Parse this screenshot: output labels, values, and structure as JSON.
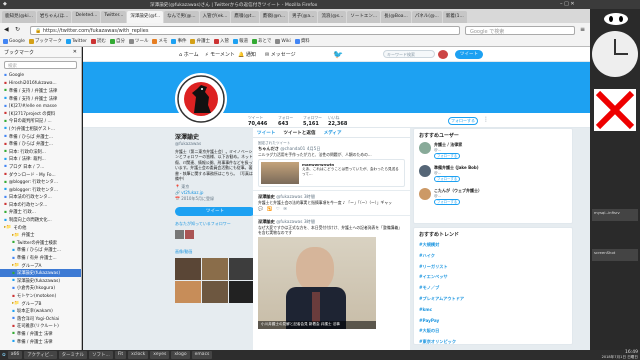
{
  "window": {
    "title": "深澤諭史(@fukazawas)さん | Twitterからの返信付きツイート - Mozilla Firefox"
  },
  "tabs": [
    "鹿知見(@ki...",
    "岩ちゃん(ほ...",
    "Deleted...",
    "Twitter...",
    "深澤諭史(@f...",
    "なんで男(@...",
    "入管が(ek...",
    "鷹嶺(@t...",
    "鷹嶺(@n...",
    "男子(@a...",
    "流浪(@s...",
    "ソートエン...",
    "長(@Boa...",
    "パネル(@...",
    "新着(1..."
  ],
  "toolbar": {
    "url": "https://twitter.com/fukazawas/with_replies",
    "search_placeholder": "Google で検索"
  },
  "bookmarks": [
    "Google",
    "ブックマーク",
    "Twitter",
    "読む",
    "自分",
    "ツール",
    "メモ",
    "事件",
    "弁護士",
    "入管",
    "報道",
    "あとで",
    "Wiki",
    "資料"
  ],
  "sidebar": {
    "title": "ブックマーク",
    "search_placeholder": "検索",
    "items": [
      {
        "label": "Google"
      },
      {
        "label": "Hiroshi2016fukzawa..."
      },
      {
        "label": "準備 / 支持 / 弁護士 法律"
      },
      {
        "label": "準備 / 支持 / 弁護士 法律"
      },
      {
        "label": "[K]27/#/elle en masse"
      },
      {
        "label": "[K]2717project の資料"
      },
      {
        "label": "今日の裁判所日記 / ..."
      },
      {
        "label": "(ク)弁護士相談ゲスト..."
      },
      {
        "label": "準備 / ひらば 弁護士..."
      },
      {
        "label": "準備 / ひらば 弁護士..."
      },
      {
        "label": "日本: 行政の法制..."
      },
      {
        "label": "日本 / 法律: 裁判..."
      },
      {
        "label": "ブログ 日本 / フ..."
      },
      {
        "label": "ダウンロード - My Fo..."
      },
      {
        "label": "@blogger: 行政センタ..."
      },
      {
        "label": "@blogger: 行政センタ..."
      },
      {
        "label": "日本法の行政センタ..."
      },
      {
        "label": "日本の行政センタ..."
      },
      {
        "label": "弁護士 行政..."
      },
      {
        "label": "制度向上の問題文化..."
      },
      {
        "label": "その他"
      },
      {
        "label": "弁護士"
      },
      {
        "label": "Twitterの弁護士検索"
      },
      {
        "label": "準備 / ひらば 弁護士..."
      },
      {
        "label": "準備 / 有弁 弁護士..."
      },
      {
        "label": "グループA"
      },
      {
        "label": "深澤諭史(fukazawas)"
      },
      {
        "label": "深澤諭史(fukazawas)"
      },
      {
        "label": "小倉秀夫(hkogura)"
      },
      {
        "label": "モトケン(motoken)"
      },
      {
        "label": "グループB"
      },
      {
        "label": "坂本正幸(wakam)"
      },
      {
        "label": "落合洋司 Yogi-Ochiai"
      },
      {
        "label": "荘司雅彦(リクルート)"
      },
      {
        "label": "準備 / 弁護士 法律"
      },
      {
        "label": "準備 / 弁護士 法律"
      }
    ]
  },
  "twitter": {
    "nav": {
      "home": "ホーム",
      "moments": "モーメント",
      "notifications": "通知",
      "messages": "メッセージ",
      "search_placeholder": "キーワード検索",
      "tweet_button": "ツイート"
    },
    "stats": [
      {
        "label": "ツイート",
        "value": "70,446"
      },
      {
        "label": "フォロー",
        "value": "643"
      },
      {
        "label": "フォロワー",
        "value": "5,161"
      },
      {
        "label": "いいね",
        "value": "22,368"
      }
    ],
    "follow_button": "フォローする",
    "profile": {
      "name": "深澤諭史",
      "handle": "@fukazawas",
      "bio": "弁護士（第二東京弁護士会）。ITイノベーションとフォロワーの皆様、以下お勧め。ネット中傷、IT関連、情報公開、刑事事件などを扱っています。弁護士会の委員会活動にも従事。著書・執筆に関する事務所はこちら。（写真は準備中）",
      "location": "東京",
      "link": "vt2fukaz.jp",
      "joined": "2010年5月に登録",
      "tweet_button": "ツイート",
      "followers_you_know": "あなたが知っているフォロワー",
      "photos_label": "画像/動画"
    },
    "timeline": {
      "tabs": [
        "ツイート",
        "ツイートと返信",
        "メディア"
      ],
      "pinned_label": "固定されたツイート",
      "tweets": [
        {
          "name": "ちゃんださ",
          "handle": "@chanda01",
          "time": "4月5日",
          "text": "ニルラグ力活用を手作ったが力と、法性の問題が、人類のための…"
        },
        {
          "name": "maewwrwnwtn",
          "handle": "@maewwrwnwtn",
          "time": "",
          "text": "えあ、これはこどうことは思っていたが、会わったら見送るって…"
        },
        {
          "name": "深澤諭史",
          "handle": "@fukazawas",
          "time": "3時間",
          "text": "弁護士と弁護士会の法的事実と指摘事項を今一度 ♪ 「ー」「（ー）（ー）」ギャッ"
        },
        {
          "name": "深澤諭史",
          "handle": "@fukazawas",
          "time": "3時間",
          "text": "なぜ大変ですかは正式な方を、本日受付付けけ、弁護士への記者発表を「整備講義」を含む実物なのです"
        }
      ],
      "tweet_caption": "小川弁護士の見解と記者会見 新着会 弁護士 法事"
    },
    "right": {
      "who_to_follow": "おすすめユーザー",
      "users": [
        {
          "name": "弁護士 / 法律家",
          "handle": "@..."
        },
        {
          "name": "準備弁護士 (Jake Bob)",
          "handle": "@..."
        },
        {
          "name": "こたんが（ウェブ弁護士）",
          "handle": "@..."
        }
      ],
      "follow_label": "フォローする",
      "trends_title": "おすすめトレンド",
      "trends": [
        "#大規模対",
        "#ハイク",
        "#リーガリスト",
        "#イエンペッサ",
        "#モノ／ブ",
        "#プレミアムアウトドア",
        "#kmc",
        "#PayPay",
        "#大阪の日",
        "#東京オリンピック"
      ]
    }
  },
  "dock": {
    "labels": [
      "mysql--infisrv",
      "screenShot"
    ]
  },
  "taskbar": {
    "items": [
      "a66",
      "アクティビ...",
      "ターミナル",
      "ソフト...",
      "Fit",
      "xclock",
      "xeyes",
      "xlogo",
      "emacs"
    ],
    "clock": "16:49",
    "date": "2018年7月1日 日曜日"
  }
}
